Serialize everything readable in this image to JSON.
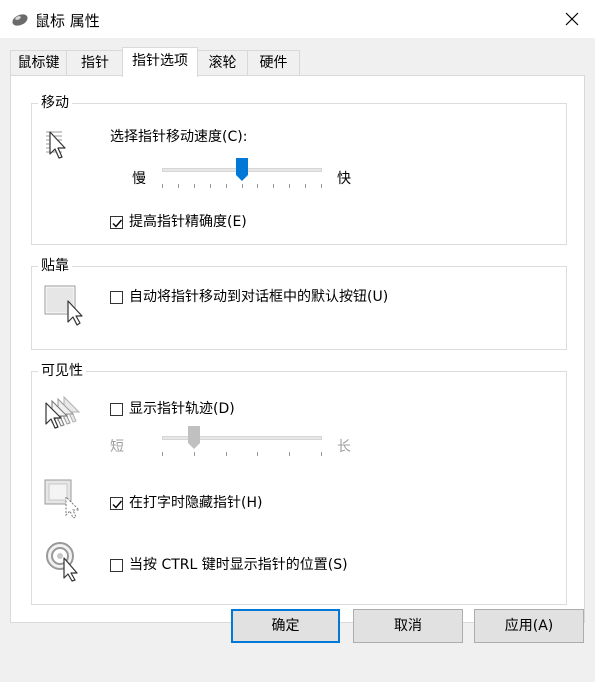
{
  "window": {
    "title": "鼠标 属性",
    "icon": "mouse-icon"
  },
  "tabs": [
    {
      "label": "鼠标键"
    },
    {
      "label": "指针"
    },
    {
      "label": "指针选项",
      "active": true
    },
    {
      "label": "滚轮"
    },
    {
      "label": "硬件"
    }
  ],
  "motion": {
    "title": "移动",
    "speed_label": "选择指针移动速度(C):",
    "slow": "慢",
    "fast": "快",
    "speed_level": 0.5,
    "precision_label": "提高指针精确度(E)",
    "precision_checked": true
  },
  "snap": {
    "title": "贴靠",
    "label": "自动将指针移动到对话框中的默认按钮(U)",
    "checked": false
  },
  "visibility": {
    "title": "可见性",
    "trails_label": "显示指针轨迹(D)",
    "trails_checked": false,
    "short": "短",
    "long": "长",
    "trails_level": 0.2,
    "hide_label": "在打字时隐藏指针(H)",
    "hide_checked": true,
    "ctrl_label": "当按 CTRL 键时显示指针的位置(S)",
    "ctrl_checked": false
  },
  "buttons": {
    "ok": "确定",
    "cancel": "取消",
    "apply": "应用(A)"
  },
  "colors": {
    "accent": "#0078d7",
    "disabled_thumb": "#c0c0c0"
  }
}
